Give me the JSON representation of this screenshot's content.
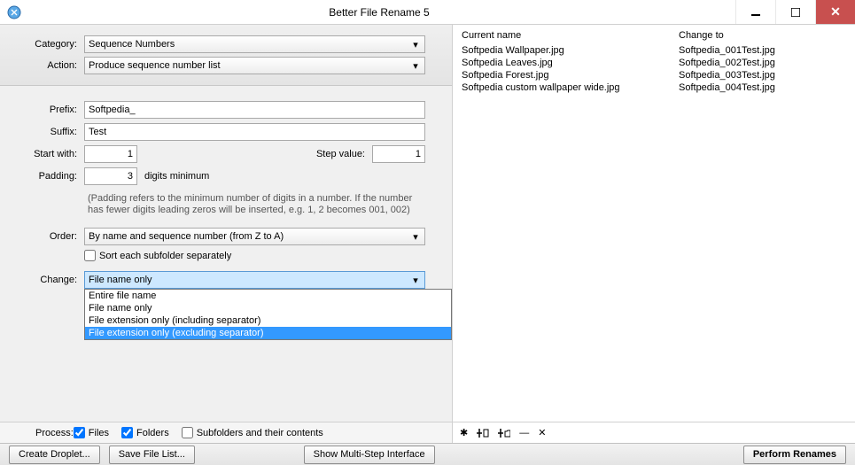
{
  "window": {
    "title": "Better File Rename 5"
  },
  "top": {
    "category_label": "Category:",
    "category_value": "Sequence Numbers",
    "action_label": "Action:",
    "action_value": "Produce sequence number list"
  },
  "form": {
    "prefix_label": "Prefix:",
    "prefix_value": "Softpedia_",
    "suffix_label": "Suffix:",
    "suffix_value": "Test",
    "start_with_label": "Start with:",
    "start_with_value": "1",
    "step_value_label": "Step value:",
    "step_value_value": "1",
    "padding_label": "Padding:",
    "padding_value": "3",
    "padding_suffix": "digits minimum",
    "padding_help": "(Padding refers to the minimum number of digits in a number. If the number has fewer digits leading zeros will be inserted, e.g. 1, 2 becomes 001, 002)",
    "order_label": "Order:",
    "order_value": "By name and sequence number (from Z to A)",
    "sort_subfolder_label": "Sort each subfolder separately",
    "change_label": "Change:",
    "change_value": "File name only",
    "change_options": [
      "Entire file name",
      "File name only",
      "File extension only (including separator)",
      "File extension only (excluding separator)"
    ]
  },
  "preview": {
    "col1_header": "Current name",
    "col2_header": "Change to",
    "rows": [
      {
        "current": "Softpedia Wallpaper.jpg",
        "changed": "Softpedia_001Test.jpg"
      },
      {
        "current": "Softpedia Leaves.jpg",
        "changed": "Softpedia_002Test.jpg"
      },
      {
        "current": "Softpedia Forest.jpg",
        "changed": "Softpedia_003Test.jpg"
      },
      {
        "current": "Softpedia custom wallpaper wide.jpg",
        "changed": "Softpedia_004Test.jpg"
      }
    ]
  },
  "process": {
    "label": "Process:",
    "files_label": "Files",
    "folders_label": "Folders",
    "subfolders_label": "Subfolders and their contents"
  },
  "buttons": {
    "create_droplet": "Create Droplet...",
    "save_file_list": "Save File List...",
    "show_multistep": "Show Multi-Step Interface",
    "perform": "Perform Renames"
  }
}
